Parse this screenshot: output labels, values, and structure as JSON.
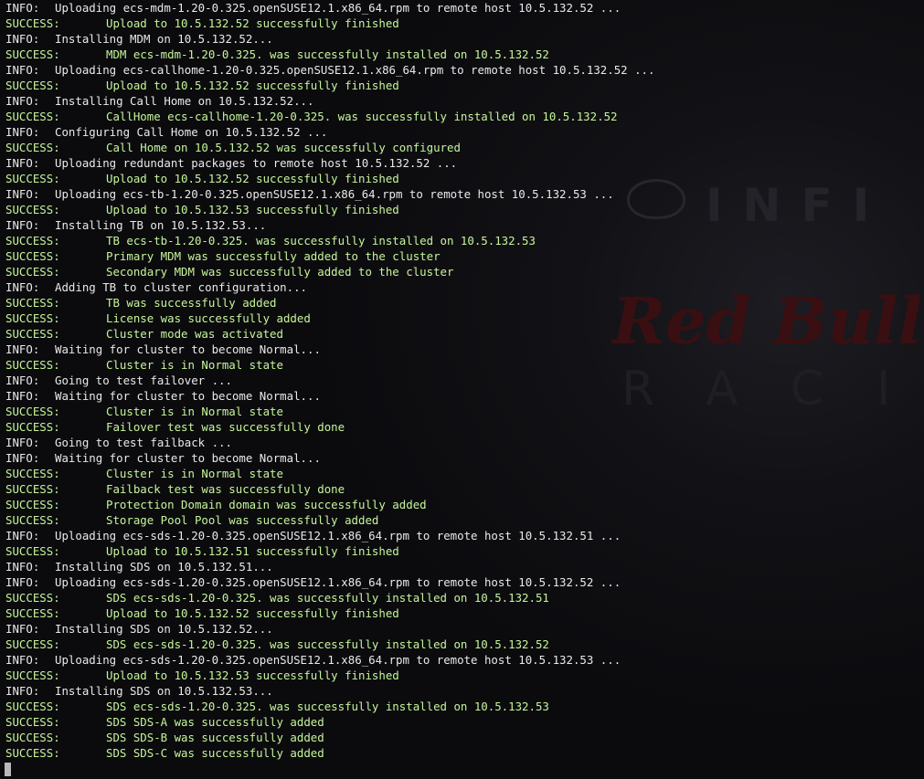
{
  "terminal": {
    "colors": {
      "background": "#0b0b0e",
      "info": "#e9e9e9",
      "success": "#c6f59a",
      "cursor": "#b9b9b9"
    },
    "lines": [
      {
        "level": "INFO:",
        "type": "info",
        "text": "Uploading ecs-mdm-1.20-0.325.openSUSE12.1.x86_64.rpm to remote host 10.5.132.52 ..."
      },
      {
        "level": "SUCCESS:",
        "type": "success",
        "text": "Upload to 10.5.132.52 successfully finished"
      },
      {
        "level": "INFO:",
        "type": "info",
        "text": "Installing MDM on 10.5.132.52..."
      },
      {
        "level": "SUCCESS:",
        "type": "success",
        "text": "MDM ecs-mdm-1.20-0.325. was successfully installed on 10.5.132.52"
      },
      {
        "level": "INFO:",
        "type": "info",
        "text": "Uploading ecs-callhome-1.20-0.325.openSUSE12.1.x86_64.rpm to remote host 10.5.132.52 ..."
      },
      {
        "level": "SUCCESS:",
        "type": "success",
        "text": "Upload to 10.5.132.52 successfully finished"
      },
      {
        "level": "INFO:",
        "type": "info",
        "text": "Installing Call Home on 10.5.132.52..."
      },
      {
        "level": "SUCCESS:",
        "type": "success",
        "text": "CallHome ecs-callhome-1.20-0.325. was successfully installed on 10.5.132.52"
      },
      {
        "level": "INFO:",
        "type": "info",
        "text": "Configuring Call Home on 10.5.132.52 ..."
      },
      {
        "level": "SUCCESS:",
        "type": "success",
        "text": "Call Home on 10.5.132.52 was successfully configured"
      },
      {
        "level": "INFO:",
        "type": "info",
        "text": "Uploading redundant packages to remote host 10.5.132.52 ..."
      },
      {
        "level": "SUCCESS:",
        "type": "success",
        "text": "Upload to 10.5.132.52 successfully finished"
      },
      {
        "level": "INFO:",
        "type": "info",
        "text": "Uploading ecs-tb-1.20-0.325.openSUSE12.1.x86_64.rpm to remote host 10.5.132.53 ..."
      },
      {
        "level": "SUCCESS:",
        "type": "success",
        "text": "Upload to 10.5.132.53 successfully finished"
      },
      {
        "level": "INFO:",
        "type": "info",
        "text": "Installing TB on 10.5.132.53..."
      },
      {
        "level": "SUCCESS:",
        "type": "success",
        "text": "TB ecs-tb-1.20-0.325. was successfully installed on 10.5.132.53"
      },
      {
        "level": "SUCCESS:",
        "type": "success",
        "text": "Primary MDM was successfully added to the cluster"
      },
      {
        "level": "SUCCESS:",
        "type": "success",
        "text": "Secondary MDM was successfully added to the cluster"
      },
      {
        "level": "INFO:",
        "type": "info",
        "text": "Adding TB to cluster configuration..."
      },
      {
        "level": "SUCCESS:",
        "type": "success",
        "text": "TB was successfully added"
      },
      {
        "level": "SUCCESS:",
        "type": "success",
        "text": "License was successfully added"
      },
      {
        "level": "SUCCESS:",
        "type": "success",
        "text": "Cluster mode was activated"
      },
      {
        "level": "INFO:",
        "type": "info",
        "text": "Waiting for cluster to become Normal..."
      },
      {
        "level": "SUCCESS:",
        "type": "success",
        "text": "Cluster is in Normal state"
      },
      {
        "level": "INFO:",
        "type": "info",
        "text": "Going to test failover ..."
      },
      {
        "level": "INFO:",
        "type": "info",
        "text": "Waiting for cluster to become Normal..."
      },
      {
        "level": "SUCCESS:",
        "type": "success",
        "text": "Cluster is in Normal state"
      },
      {
        "level": "SUCCESS:",
        "type": "success",
        "text": "Failover test was successfully done"
      },
      {
        "level": "INFO:",
        "type": "info",
        "text": "Going to test failback ..."
      },
      {
        "level": "INFO:",
        "type": "info",
        "text": "Waiting for cluster to become Normal..."
      },
      {
        "level": "SUCCESS:",
        "type": "success",
        "text": "Cluster is in Normal state"
      },
      {
        "level": "SUCCESS:",
        "type": "success",
        "text": "Failback test was successfully done"
      },
      {
        "level": "SUCCESS:",
        "type": "success",
        "text": "Protection Domain domain was successfully added"
      },
      {
        "level": "SUCCESS:",
        "type": "success",
        "text": "Storage Pool Pool was successfully added"
      },
      {
        "level": "INFO:",
        "type": "info",
        "text": "Uploading ecs-sds-1.20-0.325.openSUSE12.1.x86_64.rpm to remote host 10.5.132.51 ..."
      },
      {
        "level": "SUCCESS:",
        "type": "success",
        "text": "Upload to 10.5.132.51 successfully finished"
      },
      {
        "level": "INFO:",
        "type": "info",
        "text": "Installing SDS on 10.5.132.51..."
      },
      {
        "level": "INFO:",
        "type": "info",
        "text": "Uploading ecs-sds-1.20-0.325.openSUSE12.1.x86_64.rpm to remote host 10.5.132.52 ..."
      },
      {
        "level": "SUCCESS:",
        "type": "success",
        "text": "SDS ecs-sds-1.20-0.325. was successfully installed on 10.5.132.51"
      },
      {
        "level": "SUCCESS:",
        "type": "success",
        "text": "Upload to 10.5.132.52 successfully finished"
      },
      {
        "level": "INFO:",
        "type": "info",
        "text": "Installing SDS on 10.5.132.52..."
      },
      {
        "level": "SUCCESS:",
        "type": "success",
        "text": "SDS ecs-sds-1.20-0.325. was successfully installed on 10.5.132.52"
      },
      {
        "level": "INFO:",
        "type": "info",
        "text": "Uploading ecs-sds-1.20-0.325.openSUSE12.1.x86_64.rpm to remote host 10.5.132.53 ..."
      },
      {
        "level": "SUCCESS:",
        "type": "success",
        "text": "Upload to 10.5.132.53 successfully finished"
      },
      {
        "level": "INFO:",
        "type": "info",
        "text": "Installing SDS on 10.5.132.53..."
      },
      {
        "level": "SUCCESS:",
        "type": "success",
        "text": "SDS ecs-sds-1.20-0.325. was successfully installed on 10.5.132.53"
      },
      {
        "level": "SUCCESS:",
        "type": "success",
        "text": "SDS SDS-A was successfully added"
      },
      {
        "level": "SUCCESS:",
        "type": "success",
        "text": "SDS SDS-B was successfully added"
      },
      {
        "level": "SUCCESS:",
        "type": "success",
        "text": "SDS SDS-C was successfully added"
      }
    ]
  }
}
